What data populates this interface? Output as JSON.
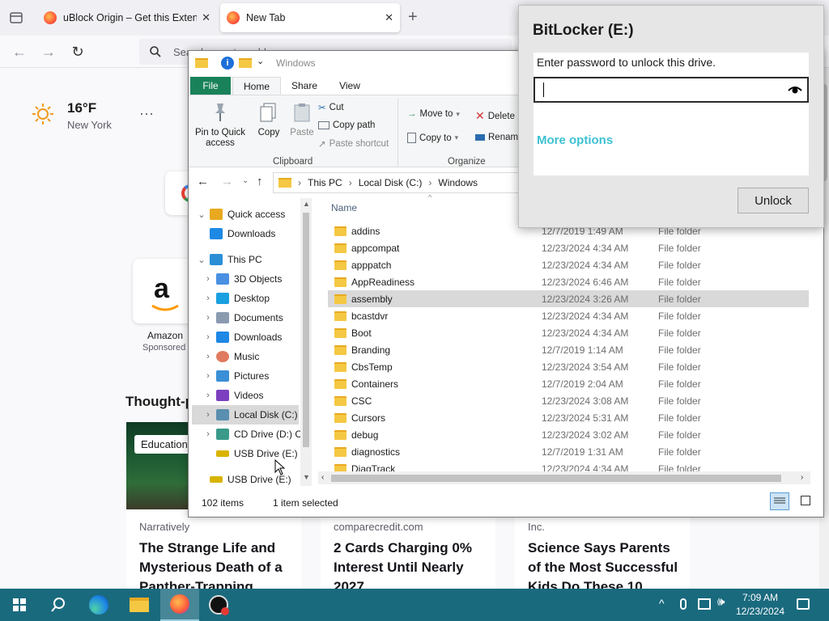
{
  "browser": {
    "tabs": [
      {
        "title": "uBlock Origin – Get this Extension for",
        "active": false
      },
      {
        "title": "New Tab",
        "active": true
      }
    ],
    "url_placeholder": "Search or enter address"
  },
  "newtab": {
    "weather": {
      "temp": "16°F",
      "city": "New York"
    },
    "shortcut": {
      "name": "Amazon",
      "sponsored": "Sponsored"
    },
    "section_title": "Thought-provoking",
    "education_tag": "Education",
    "cards": [
      {
        "source": "Narratively",
        "headline": "The Strange Life and Mysterious Death of a Panther-Trapping"
      },
      {
        "source": "comparecredit.com",
        "headline": "2 Cards Charging 0% Interest Until Nearly 2027"
      },
      {
        "source": "Inc.",
        "headline": "Science Says Parents of the Most Successful Kids Do These 10"
      }
    ]
  },
  "explorer": {
    "title": "Windows",
    "ribbon_tabs": [
      "File",
      "Home",
      "Share",
      "View"
    ],
    "clipboard": {
      "pin": "Pin to Quick access",
      "copy": "Copy",
      "paste": "Paste",
      "cut": "Cut",
      "copy_path": "Copy path",
      "paste_shortcut": "Paste shortcut",
      "group": "Clipboard"
    },
    "organize": {
      "move_to": "Move to",
      "copy_to": "Copy to",
      "delete": "Delete",
      "rename": "Rename",
      "group": "Organize"
    },
    "breadcrumb": [
      "This PC",
      "Local Disk (C:)",
      "Windows"
    ],
    "column_name": "Name",
    "nav": [
      {
        "label": "Quick access",
        "level": 0,
        "arrow": "v",
        "color": "#e8a920"
      },
      {
        "label": "Downloads",
        "level": 1,
        "arrow": "",
        "color": "#1e88e5"
      },
      {
        "label": "This PC",
        "level": 0,
        "arrow": "v",
        "color": "#2b8fd6"
      },
      {
        "label": "3D Objects",
        "level": 1,
        "arrow": ">",
        "color": "#4a90e2"
      },
      {
        "label": "Desktop",
        "level": 1,
        "arrow": ">",
        "color": "#1aa0e0"
      },
      {
        "label": "Documents",
        "level": 1,
        "arrow": ">",
        "color": "#8a9bb0"
      },
      {
        "label": "Downloads",
        "level": 1,
        "arrow": ">",
        "color": "#1e88e5"
      },
      {
        "label": "Music",
        "level": 1,
        "arrow": ">",
        "color": "#e07a5f"
      },
      {
        "label": "Pictures",
        "level": 1,
        "arrow": ">",
        "color": "#3a8fd6"
      },
      {
        "label": "Videos",
        "level": 1,
        "arrow": ">",
        "color": "#7b3fbf"
      },
      {
        "label": "Local Disk (C:)",
        "level": 1,
        "arrow": ">",
        "color": "#5a8fb0",
        "selected": true
      },
      {
        "label": "CD Drive (D:) C",
        "level": 1,
        "arrow": ">",
        "color": "#3a9a8a"
      },
      {
        "label": "USB Drive (E:)",
        "level": 1,
        "arrow": "",
        "color": "#d8b400"
      },
      {
        "label": "USB Drive (E:)",
        "level": 0,
        "arrow": "",
        "color": "#d8b400"
      }
    ],
    "files": [
      {
        "name": "addins",
        "date": "12/7/2019 1:49 AM",
        "type": "File folder"
      },
      {
        "name": "appcompat",
        "date": "12/23/2024 4:34 AM",
        "type": "File folder"
      },
      {
        "name": "apppatch",
        "date": "12/23/2024 4:34 AM",
        "type": "File folder"
      },
      {
        "name": "AppReadiness",
        "date": "12/23/2024 6:46 AM",
        "type": "File folder"
      },
      {
        "name": "assembly",
        "date": "12/23/2024 3:26 AM",
        "type": "File folder",
        "selected": true
      },
      {
        "name": "bcastdvr",
        "date": "12/23/2024 4:34 AM",
        "type": "File folder"
      },
      {
        "name": "Boot",
        "date": "12/23/2024 4:34 AM",
        "type": "File folder"
      },
      {
        "name": "Branding",
        "date": "12/7/2019 1:14 AM",
        "type": "File folder"
      },
      {
        "name": "CbsTemp",
        "date": "12/23/2024 3:54 AM",
        "type": "File folder"
      },
      {
        "name": "Containers",
        "date": "12/7/2019 2:04 AM",
        "type": "File folder"
      },
      {
        "name": "CSC",
        "date": "12/23/2024 3:08 AM",
        "type": "File folder"
      },
      {
        "name": "Cursors",
        "date": "12/23/2024 5:31 AM",
        "type": "File folder"
      },
      {
        "name": "debug",
        "date": "12/23/2024 3:02 AM",
        "type": "File folder"
      },
      {
        "name": "diagnostics",
        "date": "12/7/2019 1:31 AM",
        "type": "File folder"
      },
      {
        "name": "DiagTrack",
        "date": "12/23/2024 4:34 AM",
        "type": "File folder"
      }
    ],
    "status": {
      "count": "102 items",
      "selected": "1 item selected"
    }
  },
  "bitlocker": {
    "title": "BitLocker (E:)",
    "prompt": "Enter password to unlock this drive.",
    "password_value": "",
    "more_options": "More options",
    "unlock": "Unlock",
    "accent": "#3ec1d3"
  },
  "taskbar": {
    "time": "7:09 AM",
    "date": "12/23/2024",
    "color": "#1a6a7e"
  }
}
